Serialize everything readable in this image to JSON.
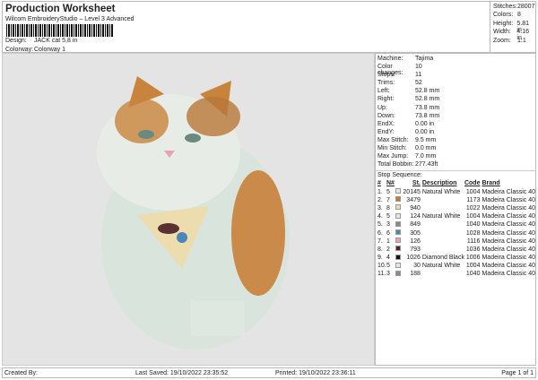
{
  "header": {
    "title": "Production Worksheet",
    "subtitle": "Wilcom EmbroideryStudio – Level 3 Advanced",
    "design_label": "Design:",
    "design_value": "JACK cat 5,8 in",
    "colorway_label": "Colorway:",
    "colorway_value": "Colorway 1"
  },
  "stats": [
    {
      "k": "Stitches:",
      "v": "28007"
    },
    {
      "k": "Colors:",
      "v": "8"
    },
    {
      "k": "Height:",
      "v": "5.81 in"
    },
    {
      "k": "Width:",
      "v": "4.16 in"
    },
    {
      "k": "Zoom:",
      "v": "1:1"
    }
  ],
  "machine": [
    {
      "k": "Machine:",
      "v": "Tajima"
    },
    {
      "k": "Color changes:",
      "v": "10"
    },
    {
      "k": "Stops:",
      "v": "11"
    },
    {
      "k": "Trims:",
      "v": "52"
    },
    {
      "k": "Left:",
      "v": "52.8 mm"
    },
    {
      "k": "Right:",
      "v": "52.8 mm"
    },
    {
      "k": "Up:",
      "v": "73.8 mm"
    },
    {
      "k": "Down:",
      "v": "73.8 mm"
    },
    {
      "k": "EndX:",
      "v": "0.00 in"
    },
    {
      "k": "EndY:",
      "v": "0.00 in"
    },
    {
      "k": "Max Stitch:",
      "v": "9.5 mm"
    },
    {
      "k": "Min Stitch:",
      "v": "0.0 mm"
    },
    {
      "k": "Max Jump:",
      "v": "7.0 mm"
    },
    {
      "k": "Total Bobbin:",
      "v": "277.43ft"
    }
  ],
  "stop_sequence": {
    "title": "Stop Sequence:",
    "headers": [
      "#",
      "N#",
      "St.",
      "Description",
      "Code",
      "Brand"
    ],
    "rows": [
      {
        "i": "1.",
        "n": "5",
        "color": "#e4e6ea",
        "st": "20145",
        "desc": "Natural White",
        "code": "1004",
        "brand": "Madeira Classic 40"
      },
      {
        "i": "2.",
        "n": "7",
        "color": "#c8782e",
        "st": "3479",
        "desc": "",
        "code": "1173",
        "brand": "Madeira Classic 40"
      },
      {
        "i": "3.",
        "n": "8",
        "color": "#ecdcae",
        "st": "940",
        "desc": "",
        "code": "1022",
        "brand": "Madeira Classic 40"
      },
      {
        "i": "4.",
        "n": "5",
        "color": "#e4e6ea",
        "st": "124",
        "desc": "Natural White",
        "code": "1004",
        "brand": "Madeira Classic 40"
      },
      {
        "i": "5.",
        "n": "3",
        "color": "#8a8a8a",
        "st": "849",
        "desc": "",
        "code": "1040",
        "brand": "Madeira Classic 40"
      },
      {
        "i": "6.",
        "n": "6",
        "color": "#4a86b8",
        "st": "305",
        "desc": "",
        "code": "1028",
        "brand": "Madeira Classic 40"
      },
      {
        "i": "7.",
        "n": "1",
        "color": "#eaa2b8",
        "st": "126",
        "desc": "",
        "code": "1116",
        "brand": "Madeira Classic 40"
      },
      {
        "i": "8.",
        "n": "2",
        "color": "#5a1e20",
        "st": "793",
        "desc": "",
        "code": "1036",
        "brand": "Madeira Classic 40"
      },
      {
        "i": "9.",
        "n": "4",
        "color": "#111111",
        "st": "1026",
        "desc": "Diamond Black",
        "code": "1006",
        "brand": "Madeira Classic 40"
      },
      {
        "i": "10.",
        "n": "5",
        "color": "#e4e6ea",
        "st": "30",
        "desc": "Natural White",
        "code": "1004",
        "brand": "Madeira Classic 40"
      },
      {
        "i": "11.",
        "n": "3",
        "color": "#8a8a8a",
        "st": "188",
        "desc": "",
        "code": "1040",
        "brand": "Madeira Classic 40"
      }
    ]
  },
  "footer": {
    "created": "Created By:",
    "saved": "Last Saved: 19/10/2022 23:35:52",
    "printed": "Printed: 19/10/2022 23:36:11",
    "page": "Page 1 of 1"
  }
}
